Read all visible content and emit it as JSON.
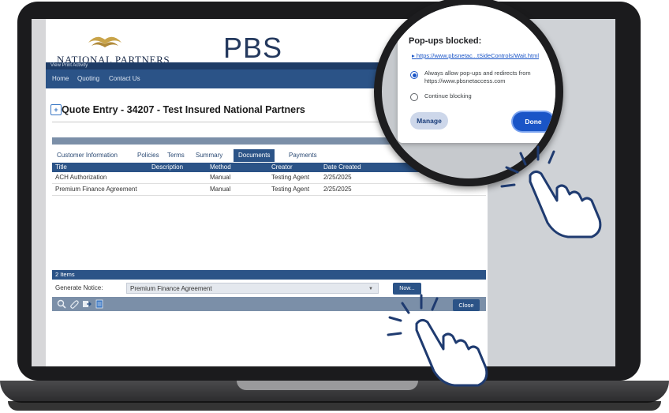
{
  "brand": {
    "name": "National Partners",
    "product": "PBS"
  },
  "app": {
    "sub_bar_text": "View Print Activity",
    "nav": [
      "Home",
      "Quoting",
      "Contact Us"
    ],
    "title": "Quote Entry - 34207 - Test Insured National Partners"
  },
  "tabs": [
    {
      "label": "Customer Information",
      "active": false
    },
    {
      "label": "Policies",
      "active": false
    },
    {
      "label": "Terms",
      "active": false
    },
    {
      "label": "Summary",
      "active": false
    },
    {
      "label": "Documents",
      "active": true
    },
    {
      "label": "Payments",
      "active": false
    }
  ],
  "table": {
    "columns": [
      "Title",
      "Description",
      "Method",
      "Creator",
      "Date Created"
    ],
    "rows": [
      [
        "ACH Authorization",
        "",
        "Manual",
        "Testing Agent",
        "2/25/2025"
      ],
      [
        "Premium Finance Agreement",
        "",
        "Manual",
        "Testing Agent",
        "2/25/2025"
      ]
    ],
    "items_count": "2 Items"
  },
  "generate_notice": {
    "label": "Generate Notice:",
    "selected": "Premium Finance Agreement",
    "now_label": "Now...",
    "close_label": "Close"
  },
  "toolbar_icons": [
    "search-icon",
    "attach-icon",
    "export-icon",
    "document-icon"
  ],
  "popup": {
    "title": "Pop-ups blocked:",
    "close_glyph": "×",
    "link": "https://www.pbsnetac...tSideControls/Wait.html",
    "option_allow": "Always allow pop-ups and redirects from https://www.pbsnetaccess.com",
    "option_block": "Continue blocking",
    "selected_option": "allow",
    "manage_label": "Manage",
    "done_label": "Done"
  },
  "colors": {
    "nav": "#2b5387",
    "dark_nav": "#1e3c66",
    "accent_blue": "#1a55c7",
    "hand_outline": "#1f3b70"
  }
}
